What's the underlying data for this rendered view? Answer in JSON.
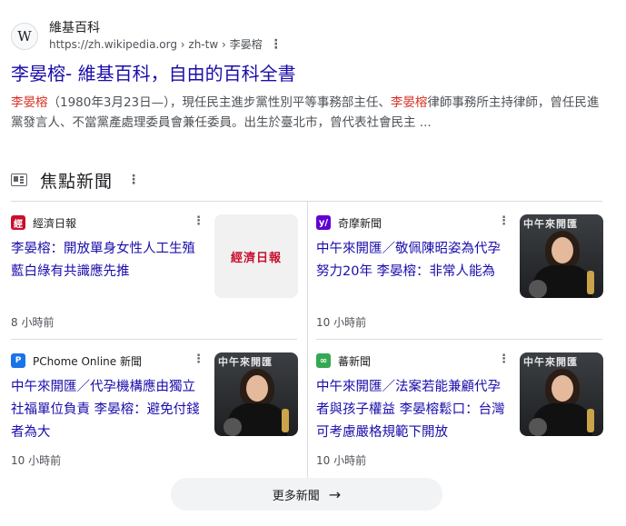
{
  "result": {
    "favicon_letter": "W",
    "site_name": "維基百科",
    "url": "https://zh.wikipedia.org › zh-tw › 李晏榕",
    "title": "李晏榕- 維基百科，自由的百科全書",
    "snippet_name_1": "李晏榕",
    "snippet_part_1": "（1980年3月23日—），現任民主進步黨性別平等事務部主任、",
    "snippet_name_2": "李晏榕",
    "snippet_part_2": "律師事務所主持律師，曾任民進黨發言人、不當黨產處理委員會兼任委員。出生於臺北市，曾代表社會民主 ..."
  },
  "top_stories": {
    "title": "焦點新聞",
    "cards": [
      {
        "publisher": "經濟日報",
        "logo_color": "#c8102e",
        "logo_glyph": "經",
        "headline": "李晏榕：開放單身女性人工生殖 藍白綠有共識應先推",
        "time": "8 小時前",
        "thumb_text": "經濟日報",
        "thumb_icon": "newspaper-logo-thumbnail"
      },
      {
        "publisher": "奇摩新聞",
        "logo_color": "#6001d2",
        "logo_glyph": "y/",
        "headline": "中午來開匯／敬佩陳昭姿為代孕努力20年 李晏榕：非常人能為",
        "time": "10 小時前",
        "thumb_text": "中午來開匯",
        "thumb_icon": "portrait-photo-thumbnail"
      },
      {
        "publisher": "PChome Online 新聞",
        "logo_color": "#1a73e8",
        "logo_glyph": "P",
        "headline": "中午來開匯／代孕機構應由獨立社福單位負責 李晏榕：避免付錢者為大",
        "time": "10 小時前",
        "thumb_text": "中午來開匯",
        "thumb_icon": "portrait-photo-thumbnail"
      },
      {
        "publisher": "蕃新聞",
        "logo_color": "#34a853",
        "logo_glyph": "∞",
        "headline": "中午來開匯／法案若能兼顧代孕者與孩子權益 李晏榕鬆口：台灣可考慮嚴格規範下開放",
        "time": "10 小時前",
        "thumb_text": "中午來開匯",
        "thumb_icon": "portrait-photo-thumbnail"
      }
    ],
    "more_label": "更多新聞"
  },
  "colors": {
    "link": "#1a0dab",
    "highlight": "#d93025",
    "muted": "#4d5156"
  }
}
